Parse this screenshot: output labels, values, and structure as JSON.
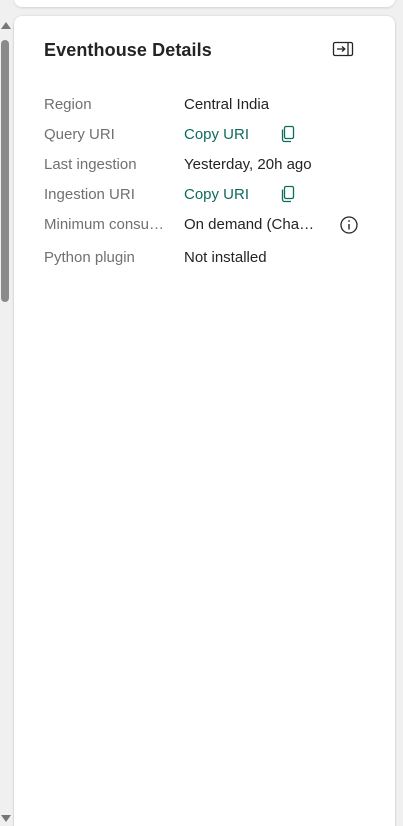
{
  "panel": {
    "title": "Eventhouse Details"
  },
  "icons": {
    "collapse": "collapse-panel-icon",
    "copy": "copy-icon",
    "info": "info-icon"
  },
  "colors": {
    "link": "#0f6b5c",
    "label": "#707070",
    "value": "#242424"
  },
  "properties": [
    {
      "label": "Region",
      "value": "Central India"
    },
    {
      "label": "Query URI",
      "value": "Copy URI"
    },
    {
      "label": "Last ingestion",
      "value": "Yesterday, 20h ago"
    },
    {
      "label": "Ingestion URI",
      "value": "Copy URI"
    },
    {
      "label": "Minimum consumption",
      "value": "On demand (Change)"
    },
    {
      "label": "Python plugin",
      "value": "Not installed"
    }
  ]
}
